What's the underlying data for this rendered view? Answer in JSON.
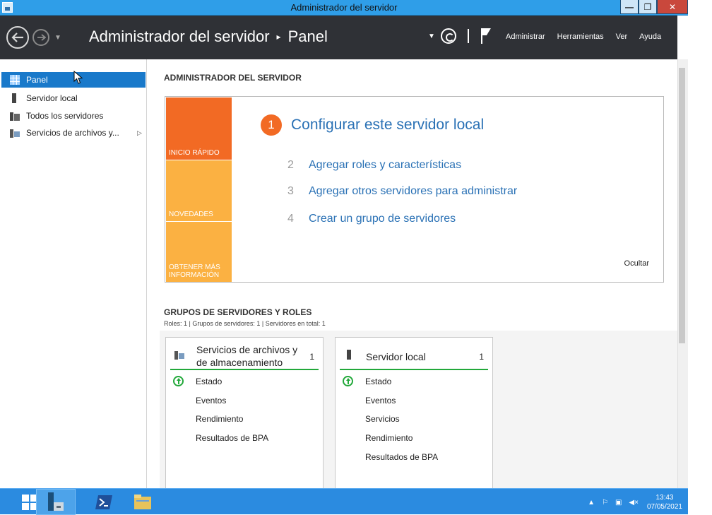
{
  "window": {
    "title": "Administrador del servidor"
  },
  "header": {
    "breadcrumb_root": "Administrador del servidor",
    "breadcrumb_sep": "▸",
    "breadcrumb_page": "Panel",
    "menus": [
      "Administrar",
      "Herramientas",
      "Ver",
      "Ayuda"
    ]
  },
  "sidebar": {
    "items": [
      {
        "label": "Panel",
        "icon": "dashboard-grid-icon",
        "active": true
      },
      {
        "label": "Servidor local",
        "icon": "server-icon"
      },
      {
        "label": "Todos los servidores",
        "icon": "servers-icon"
      },
      {
        "label": "Servicios de archivos y...",
        "icon": "file-services-icon",
        "expander": "▷"
      }
    ]
  },
  "main": {
    "title": "ADMINISTRADOR DEL SERVIDOR",
    "quickstart": {
      "tabs": [
        "INICIO RÁPIDO",
        "NOVEDADES",
        "OBTENER MÁS INFORMACIÓN"
      ],
      "steps": [
        {
          "num": "1",
          "label": "Configurar este servidor local"
        },
        {
          "num": "2",
          "label": "Agregar roles y características"
        },
        {
          "num": "3",
          "label": "Agregar otros servidores para administrar"
        },
        {
          "num": "4",
          "label": "Crear un grupo de servidores"
        }
      ],
      "hide_label": "Ocultar"
    },
    "groups": {
      "title": "GRUPOS DE SERVIDORES Y ROLES",
      "subtitle": "Roles: 1   |   Grupos de servidores: 1   |   Servidores en total: 1",
      "tiles": [
        {
          "name": "Servicios de archivos y de almacenamiento",
          "count": "1",
          "rows": [
            "Estado",
            "Eventos",
            "Rendimiento",
            "Resultados de BPA"
          ]
        },
        {
          "name": "Servidor local",
          "count": "1",
          "rows": [
            "Estado",
            "Eventos",
            "Servicios",
            "Rendimiento",
            "Resultados de BPA"
          ]
        }
      ]
    }
  },
  "taskbar": {
    "clock_time": "13:43",
    "clock_date": "07/05/2021"
  },
  "colors": {
    "accent_blue": "#1979ca",
    "quickstart_orange": "#f26a24",
    "quickstart_amber": "#fbb142",
    "status_green": "#22a83a",
    "link_blue": "#2a71b5"
  }
}
